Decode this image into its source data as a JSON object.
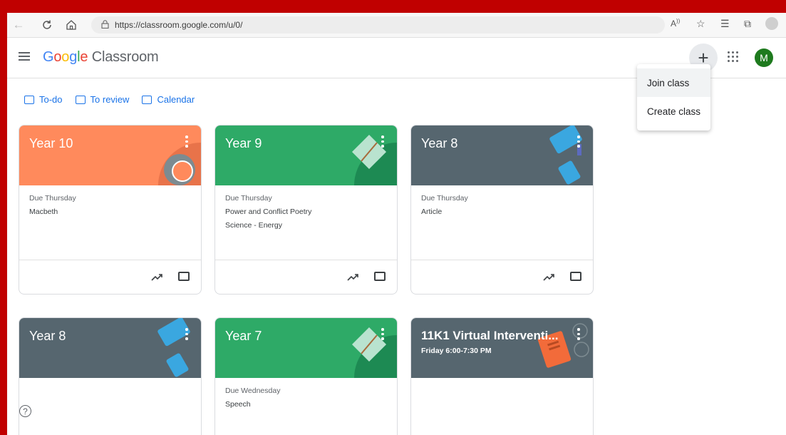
{
  "browser": {
    "url": "https://classroom.google.com/u/0/"
  },
  "app": {
    "logo_google": [
      "G",
      "o",
      "o",
      "g",
      "l",
      "e"
    ],
    "logo_product": "Classroom",
    "avatar_initial": "M"
  },
  "create_menu": {
    "items": [
      "Join class",
      "Create class"
    ]
  },
  "links": {
    "todo": "To-do",
    "to_review": "To review",
    "calendar": "Calendar"
  },
  "cards": [
    {
      "title": "Year 10",
      "subtitle": "",
      "color": "#ff8a5c",
      "due": "Due Thursday",
      "items": [
        "Macbeth"
      ]
    },
    {
      "title": "Year 9",
      "subtitle": "",
      "color": "#2eaa67",
      "due": "Due Thursday",
      "items": [
        "Power and Conflict Poetry",
        "Science - Energy"
      ]
    },
    {
      "title": "Year 8",
      "subtitle": "",
      "color": "#56666f",
      "due": "Due Thursday",
      "items": [
        "Article"
      ]
    },
    {
      "title": "Year 8",
      "subtitle": "",
      "color": "#56666f",
      "due": "",
      "items": []
    },
    {
      "title": "Year 7",
      "subtitle": "",
      "color": "#2eaa67",
      "due": "Due Wednesday",
      "items": [
        "Speech"
      ]
    },
    {
      "title": "11K1 Virtual Interventi...",
      "subtitle": "Friday 6:00-7:30 PM",
      "color": "#56666f",
      "due": "",
      "items": []
    }
  ],
  "help_glyph": "?"
}
